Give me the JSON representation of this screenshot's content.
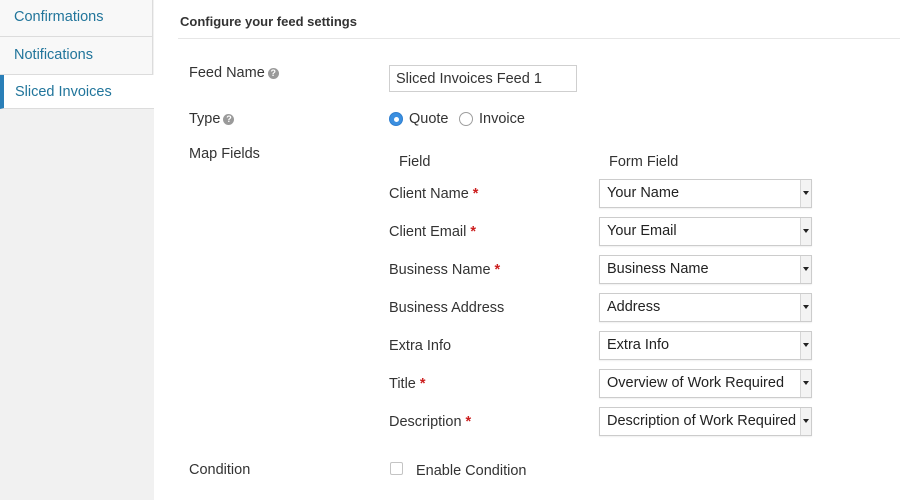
{
  "sidebar": {
    "items": [
      {
        "label": "Confirmations"
      },
      {
        "label": "Notifications"
      },
      {
        "label": "Sliced Invoices"
      }
    ]
  },
  "panel": {
    "title": "Configure your feed settings"
  },
  "feed_name": {
    "label": "Feed Name",
    "value": "Sliced Invoices Feed 1"
  },
  "type": {
    "label": "Type",
    "options": [
      {
        "label": "Quote",
        "selected": true
      },
      {
        "label": "Invoice",
        "selected": false
      }
    ]
  },
  "map_fields": {
    "label": "Map Fields",
    "col_field": "Field",
    "col_form_field": "Form Field",
    "rows": [
      {
        "field": "Client Name",
        "required": true,
        "value": "Your Name"
      },
      {
        "field": "Client Email",
        "required": true,
        "value": "Your Email"
      },
      {
        "field": "Business Name",
        "required": true,
        "value": "Business Name"
      },
      {
        "field": "Business Address",
        "required": false,
        "value": "Address"
      },
      {
        "field": "Extra Info",
        "required": false,
        "value": "Extra Info"
      },
      {
        "field": "Title",
        "required": true,
        "value": "Overview of Work Required"
      },
      {
        "field": "Description",
        "required": true,
        "value": "Description of Work Required"
      }
    ],
    "required_mark": "*"
  },
  "condition": {
    "label": "Condition",
    "checkbox_label": "Enable Condition",
    "checked": false
  },
  "help_icon_glyph": "?",
  "colors": {
    "link": "#21759b",
    "accent": "#2a7fb8",
    "required": "#cc1f1f",
    "radio_selected": "#3b8fe0"
  }
}
